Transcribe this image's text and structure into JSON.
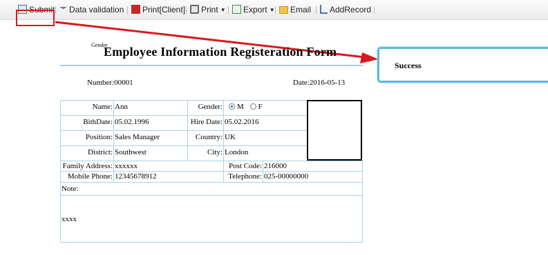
{
  "toolbar": {
    "submit": "Submit",
    "data_validation": "Data validation",
    "print_client": "Print[Client]",
    "print": "Print",
    "export": "Export",
    "email": "Email",
    "add_record": "AddRecord"
  },
  "form": {
    "gender_tag": "Gender",
    "title": "Employee Information Registeration Form",
    "number": "Number:00001",
    "date": "Date:2016-05-13",
    "rows": {
      "name_label": "Name:",
      "name_value": "Ann",
      "gender_label": "Gender:",
      "gender_m": "M",
      "gender_f": "F",
      "gender_selected": "M",
      "birth_label": "BithDate:",
      "birth_value": "05.02.1996",
      "hire_label": "Hire Date:",
      "hire_value": "05.02.2016",
      "position_label": "Position:",
      "position_value": "Sales Manager",
      "country_label": "Country:",
      "country_value": "UK",
      "district_label": "District:",
      "district_value": "Southwest",
      "city_label": "City:",
      "city_value": "London",
      "family_label": "Family Address:",
      "family_value": "xxxxxx",
      "postcode_label": "Post Code:",
      "postcode_value": "216000",
      "mobile_label": "Mobile Phone:",
      "mobile_value": "12345678912",
      "telephone_label": "Telephone:",
      "telephone_value": "025-00000000",
      "note_label": "Note:",
      "note_value": "xxxx"
    }
  },
  "popup": {
    "message": "Success"
  },
  "colors": {
    "highlight_red": "#d71920",
    "popup_border": "#5bb8dc",
    "grid_line": "#a9d3e3"
  }
}
